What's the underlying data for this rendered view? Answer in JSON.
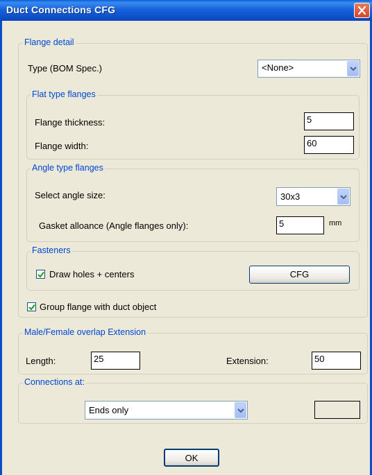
{
  "window": {
    "title": "Duct Connections CFG"
  },
  "flange_detail": {
    "legend": "Flange detail",
    "type_label": "Type (BOM Spec.)",
    "type_value": "<None>",
    "flat": {
      "legend": "Flat type flanges",
      "thickness_label": "Flange thickness:",
      "thickness_value": "5",
      "width_label": "Flange width:",
      "width_value": "60"
    },
    "angle": {
      "legend": "Angle type flanges",
      "size_label": "Select angle size:",
      "size_value": "30x3",
      "gasket_label": "Gasket alloance (Angle flanges only):",
      "gasket_value": "5",
      "gasket_unit": "mm"
    },
    "fasteners": {
      "legend": "Fasteners",
      "draw_holes_label": "Draw holes + centers",
      "draw_holes_checked": true,
      "cfg_button": "CFG"
    },
    "group_label": "Group flange with duct object",
    "group_checked": true
  },
  "overlap": {
    "legend": "Male/Female overlap  Extension",
    "length_label": "Length:",
    "length_value": "25",
    "extension_label": "Extension:",
    "extension_value": "50"
  },
  "connections": {
    "legend": "Connections at:",
    "value": "Ends only",
    "extra_value": ""
  },
  "ok_button": "OK",
  "icons": {
    "close": "close-icon",
    "dropdown": "chevron-down-icon",
    "check": "check-icon"
  },
  "colors": {
    "titlebar": "#0b4fc8",
    "legend": "#0046d5",
    "dialog_bg": "#ece9d8",
    "close": "#d4472b"
  }
}
